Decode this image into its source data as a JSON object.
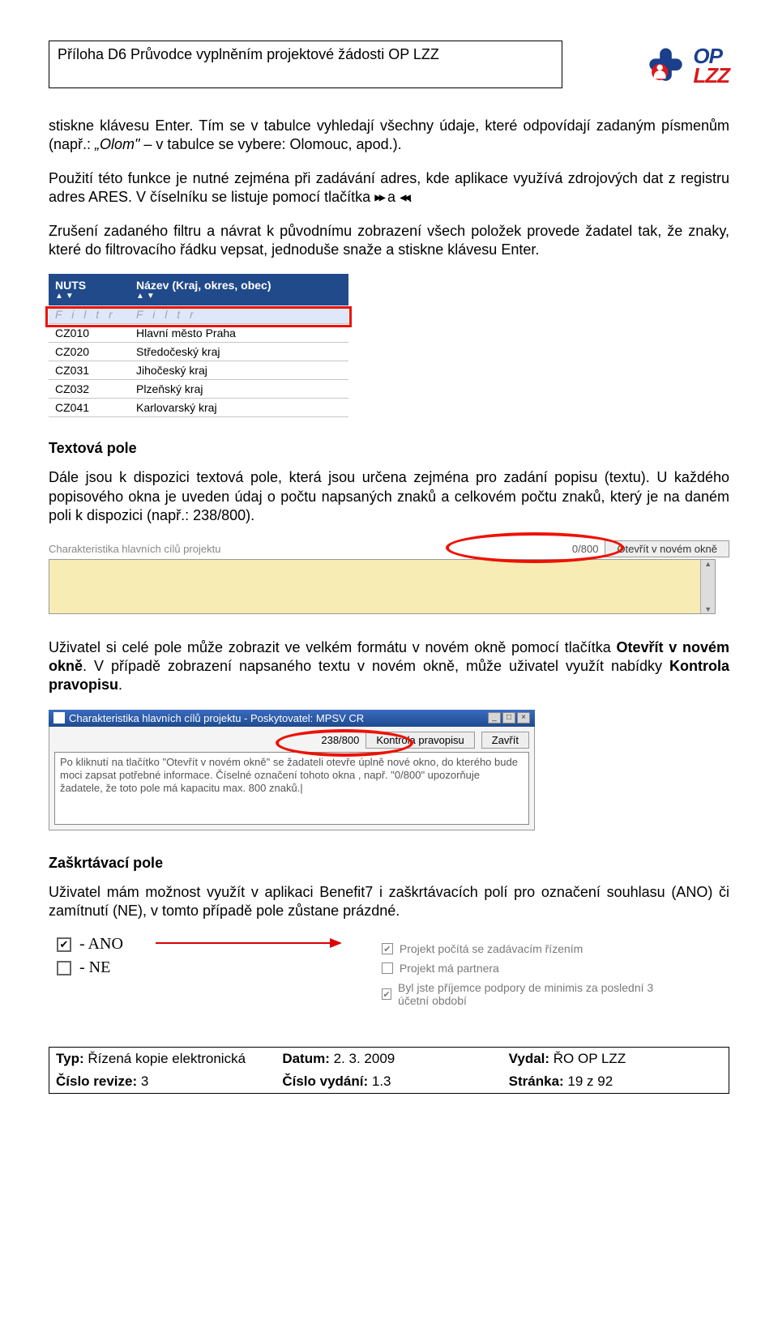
{
  "header": {
    "title": "Příloha D6 Průvodce vyplněním projektové žádosti OP LZZ",
    "logo_top": "OP",
    "logo_bottom": "LZZ"
  },
  "para1_a": "stiskne klávesu Enter. Tím se v tabulce vyhledají všechny údaje, které odpovídají zadaným písmenům (např.: ",
  "para1_i": "„Olom\"",
  "para1_b": " – v tabulce se vybere: Olomouc, apod.).",
  "para2_a": "Použití této funkce je nutné zejména při zadávání adres, kde aplikace využívá zdrojových dat z registru adres ARES. V číselníku se listuje pomocí tlačítka ",
  "para2_b": " a ",
  "para2_c": ".",
  "icon_fwd": "▶▶",
  "icon_back": "◀◀",
  "para3": "Zrušení zadaného filtru a návrat k původnímu zobrazení všech položek provede žadatel tak, že znaky, které do filtrovacího řádku vepsat, jednoduše snaže a stiskne klávesu Enter.",
  "nuts": {
    "h1": "NUTS",
    "h2": "Název (Kraj, okres, obec)",
    "sort": "▲▼",
    "filter": "F i l t r",
    "rows": [
      {
        "code": "CZ010",
        "name": "Hlavní město Praha"
      },
      {
        "code": "CZ020",
        "name": "Středočeský kraj"
      },
      {
        "code": "CZ031",
        "name": "Jihočeský kraj"
      },
      {
        "code": "CZ032",
        "name": "Plzeňský kraj"
      },
      {
        "code": "CZ041",
        "name": "Karlovarský kraj"
      }
    ]
  },
  "sec_text_heading": "Textová pole",
  "para4": "Dále jsou k dispozici textová pole, která jsou určena zejména pro zadání popisu (textu). U každého popisového okna je uveden údaj o počtu napsaných znaků a celkovém počtu znaků, který je na daném poli k dispozici (např.: 238/800).",
  "charcount": {
    "label": "Charakteristika hlavních cílů projektu",
    "value": "0/800",
    "open_btn": "Otevřít v novém okně"
  },
  "para5_a": "Uživatel si celé pole může zobrazit ve velkém formátu v novém okně pomocí tlačítka ",
  "para5_b": "Otevřít v novém okně",
  "para5_c": ". V případě zobrazení napsaného textu v novém okně, může uživatel využít nabídky ",
  "para5_d": "Kontrola pravopisu",
  "para5_e": ".",
  "popup": {
    "title": "Charakteristika hlavních cílů projektu - Poskytovatel: MPSV CR",
    "count": "238/800",
    "btn_spell": "Kontrola pravopisu",
    "btn_close": "Zavřít",
    "text": "Po kliknutí na tlačítko \"Otevřít v novém okně\" se žadateli otevře úplně nové okno, do kterého bude moci zapsat potřebné informace. Číselné označení tohoto okna , např. \"0/800\" upozorňuje žadatele, že toto pole má kapacitu max. 800 znaků.|"
  },
  "sec_check_heading": "Zaškrtávací pole",
  "para6": "Uživatel mám možnost využít v aplikaci Benefit7 i zaškrtávacích polí pro označení souhlasu (ANO) či zamítnutí (NE), v tomto případě pole zůstane prázdné.",
  "legend_yes": "- ANO",
  "legend_no": "- NE",
  "checks": {
    "c1": "Projekt počítá se zadávacím řízením",
    "c2": "Projekt má partnera",
    "c3": "Byl jste příjemce podpory de minimis za poslední 3 účetní období"
  },
  "footer": {
    "type_label": "Typ:",
    "type_val": "Řízená kopie elektronická",
    "date_label": "Datum:",
    "date_val": "2. 3. 2009",
    "issued_label": "Vydal:",
    "issued_val": "ŘO OP LZZ",
    "rev_label": "Číslo revize:",
    "rev_val": "3",
    "ed_label": "Číslo vydání:",
    "ed_val": "1.3",
    "page_label": "Stránka:",
    "page_val": "19 z 92"
  }
}
